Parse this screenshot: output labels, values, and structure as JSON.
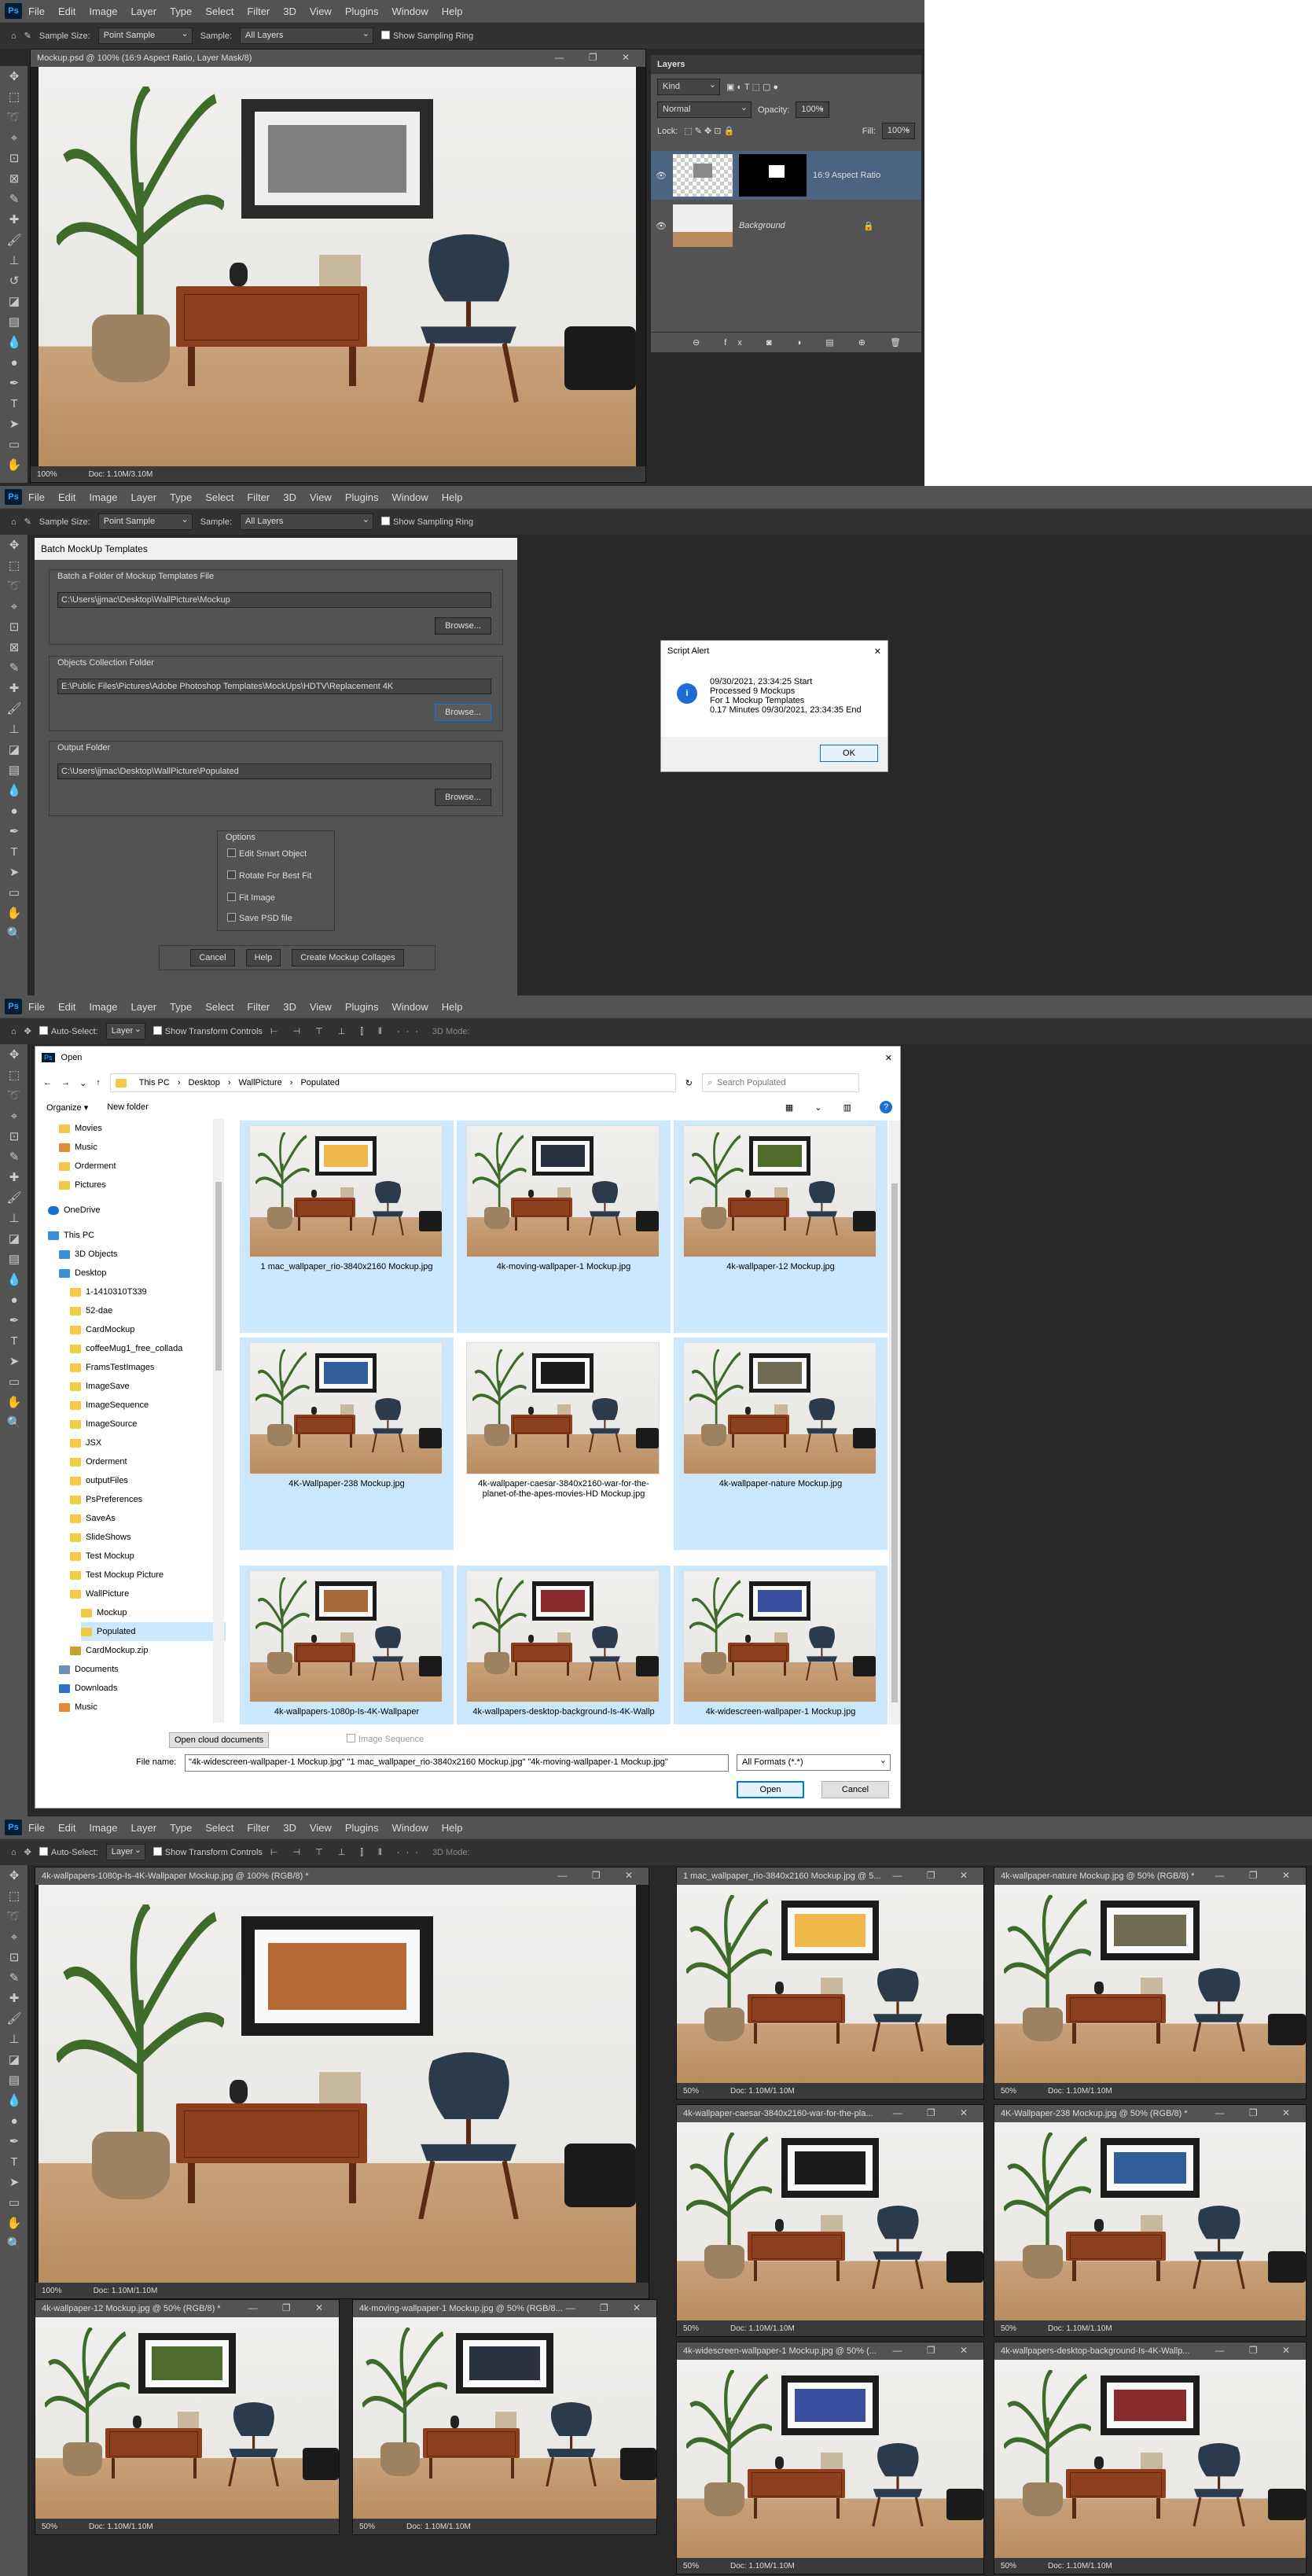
{
  "shared": {
    "menu": [
      "File",
      "Edit",
      "Image",
      "Layer",
      "Type",
      "Select",
      "Filter",
      "3D",
      "View",
      "Plugins",
      "Window",
      "Help"
    ],
    "ps_logo": "Ps",
    "sample_size_label": "Sample Size:",
    "sample_size_value": "Point Sample",
    "sample_label": "Sample:",
    "sample_value": "All Layers",
    "show_sampling_ring": "Show Sampling Ring",
    "auto_select": "Auto-Select:",
    "auto_select_value": "Layer",
    "show_transform": "Show Transform Controls",
    "mode_3d": "3D Mode:",
    "window_controls": "— ❐ ✕"
  },
  "panel1": {
    "doc_title": "Mockup.psd @ 100% (16:9 Aspect Ratio, Layer Mask/8)",
    "zoom": "100%",
    "doc_info": "Doc: 1.10M/3.10M",
    "layers_tab": "Layers",
    "kind": "Kind",
    "blend": "Normal",
    "opacity_label": "Opacity:",
    "opacity": "100%",
    "lock_label": "Lock:",
    "fill_label": "Fill:",
    "fill": "100%",
    "layer1": "16:9 Aspect Ratio",
    "layer2": "Background"
  },
  "panel2": {
    "dialog_title": "Batch MockUp Templates",
    "g1_label": "Batch a Folder of Mockup Templates File",
    "g1_path": "C:\\Users\\jjmac\\Desktop\\WallPicture\\Mockup",
    "g2_label": "Objects Collection Folder",
    "g2_path": "E:\\Public Files\\Pictures\\Adobe Photoshop Templates\\MockUps\\HDTV\\Replacement 4K",
    "g3_label": "Output Folder",
    "g3_path": "C:\\Users\\jjmac\\Desktop\\WallPicture\\Populated",
    "browse": "Browse...",
    "options": "Options",
    "opt1": "Edit Smart Object",
    "opt2": "Rotate For Best Fit",
    "opt3": "Fit Image",
    "opt4": "Save PSD file",
    "cancel": "Cancel",
    "help": "Help",
    "create": "Create Mockup Collages",
    "alert_title": "Script Alert",
    "alert_l1": "09/30/2021, 23:34:25 Start",
    "alert_l2": "Processed 9 Mockups",
    "alert_l3": "For 1 Mockup Templates",
    "alert_l4": "0.17 Minutes 09/30/2021, 23:34:35  End",
    "ok": "OK"
  },
  "panel3": {
    "title": "Open",
    "crumbs": [
      "This PC",
      "Desktop",
      "WallPicture",
      "Populated"
    ],
    "search": "Search Populated",
    "organize": "Organize ▾",
    "new_folder": "New folder",
    "tree": [
      "Movies",
      "Music",
      "Orderment",
      "Pictures",
      "OneDrive",
      "This PC",
      "3D Objects",
      "Desktop",
      "1-1410310T339",
      "52-dae",
      "CardMockup",
      "coffeeMug1_free_collada",
      "FramsTestImages",
      "ImageSave",
      "ImageSequence",
      "ImageSource",
      "JSX",
      "Orderment",
      "outputFiles",
      "PsPreferences",
      "SaveAs",
      "SlideShows",
      "Test Mockup",
      "Test Mockup Picture",
      "WallPicture",
      "Mockup",
      "Populated",
      "CardMockup.zip",
      "Documents",
      "Downloads",
      "Music"
    ],
    "files": [
      "1 mac_wallpaper_rio-3840x2160 Mockup.jpg",
      "4k-moving-wallpaper-1 Mockup.jpg",
      "4k-wallpaper-12 Mockup.jpg",
      "4K-Wallpaper-238 Mockup.jpg",
      "4k-wallpaper-caesar-3840x2160-war-for-the-planet-of-the-apes-movies-HD Mockup.jpg",
      "4k-wallpaper-nature Mockup.jpg",
      "4k-wallpapers-1080p-Is-4K-Wallpaper",
      "4k-wallpapers-desktop-background-Is-4K-Wallp",
      "4k-widescreen-wallpaper-1 Mockup.jpg"
    ],
    "open_cloud": "Open cloud documents",
    "image_sequence": "Image Sequence",
    "file_name_label": "File name:",
    "file_name": "\"4k-widescreen-wallpaper-1 Mockup.jpg\" \"1 mac_wallpaper_rio-3840x2160 Mockup.jpg\" \"4k-moving-wallpaper-1 Mockup.jpg\"",
    "format": "All Formats (*.*)",
    "open": "Open",
    "cancel": "Cancel"
  },
  "panel4": {
    "docs": [
      {
        "title": "4k-wallpapers-1080p-Is-4K-Wallpaper Mockup.jpg @ 100% (RGB/8) *",
        "zoom": "100%",
        "info": "Doc: 1.10M/1.10M"
      },
      {
        "title": "1 mac_wallpaper_rio-3840x2160 Mockup.jpg @ 5...",
        "zoom": "50%",
        "info": "Doc: 1.10M/1.10M"
      },
      {
        "title": "4k-wallpaper-nature Mockup.jpg @ 50% (RGB/8) *",
        "zoom": "50%",
        "info": "Doc: 1.10M/1.10M"
      },
      {
        "title": "4k-wallpaper-caesar-3840x2160-war-for-the-pla...",
        "zoom": "50%",
        "info": "Doc: 1.10M/1.10M"
      },
      {
        "title": "4K-Wallpaper-238 Mockup.jpg @ 50% (RGB/8) *",
        "zoom": "50%",
        "info": "Doc: 1.10M/1.10M"
      },
      {
        "title": "4k-wallpaper-12 Mockup.jpg @ 50% (RGB/8) *",
        "zoom": "50%",
        "info": "Doc: 1.10M/1.10M"
      },
      {
        "title": "4k-moving-wallpaper-1 Mockup.jpg @ 50% (RGB/8...",
        "zoom": "50%",
        "info": "Doc: 1.10M/1.10M"
      },
      {
        "title": "4k-widescreen-wallpaper-1 Mockup.jpg @ 50% (...",
        "zoom": "50%",
        "info": "Doc: 1.10M/1.10M"
      },
      {
        "title": "4k-wallpapers-desktop-background-Is-4K-Wallp...",
        "zoom": "50%",
        "info": "Doc: 1.10M/1.10M"
      }
    ]
  },
  "colors": {
    "ps_dark": "#282828",
    "ps_mid": "#535353",
    "selection": "#cce8ff",
    "accent": "#0078d7"
  },
  "icons": [
    "move-icon",
    "marquee-icon",
    "lasso-icon",
    "crop-icon",
    "eyedropper-icon",
    "brush-icon",
    "eraser-icon",
    "gradient-icon",
    "pen-icon",
    "type-icon",
    "hand-icon",
    "zoom-icon",
    "eye-icon",
    "lock-icon",
    "folder-icon",
    "search-icon",
    "refresh-icon",
    "info-icon"
  ]
}
